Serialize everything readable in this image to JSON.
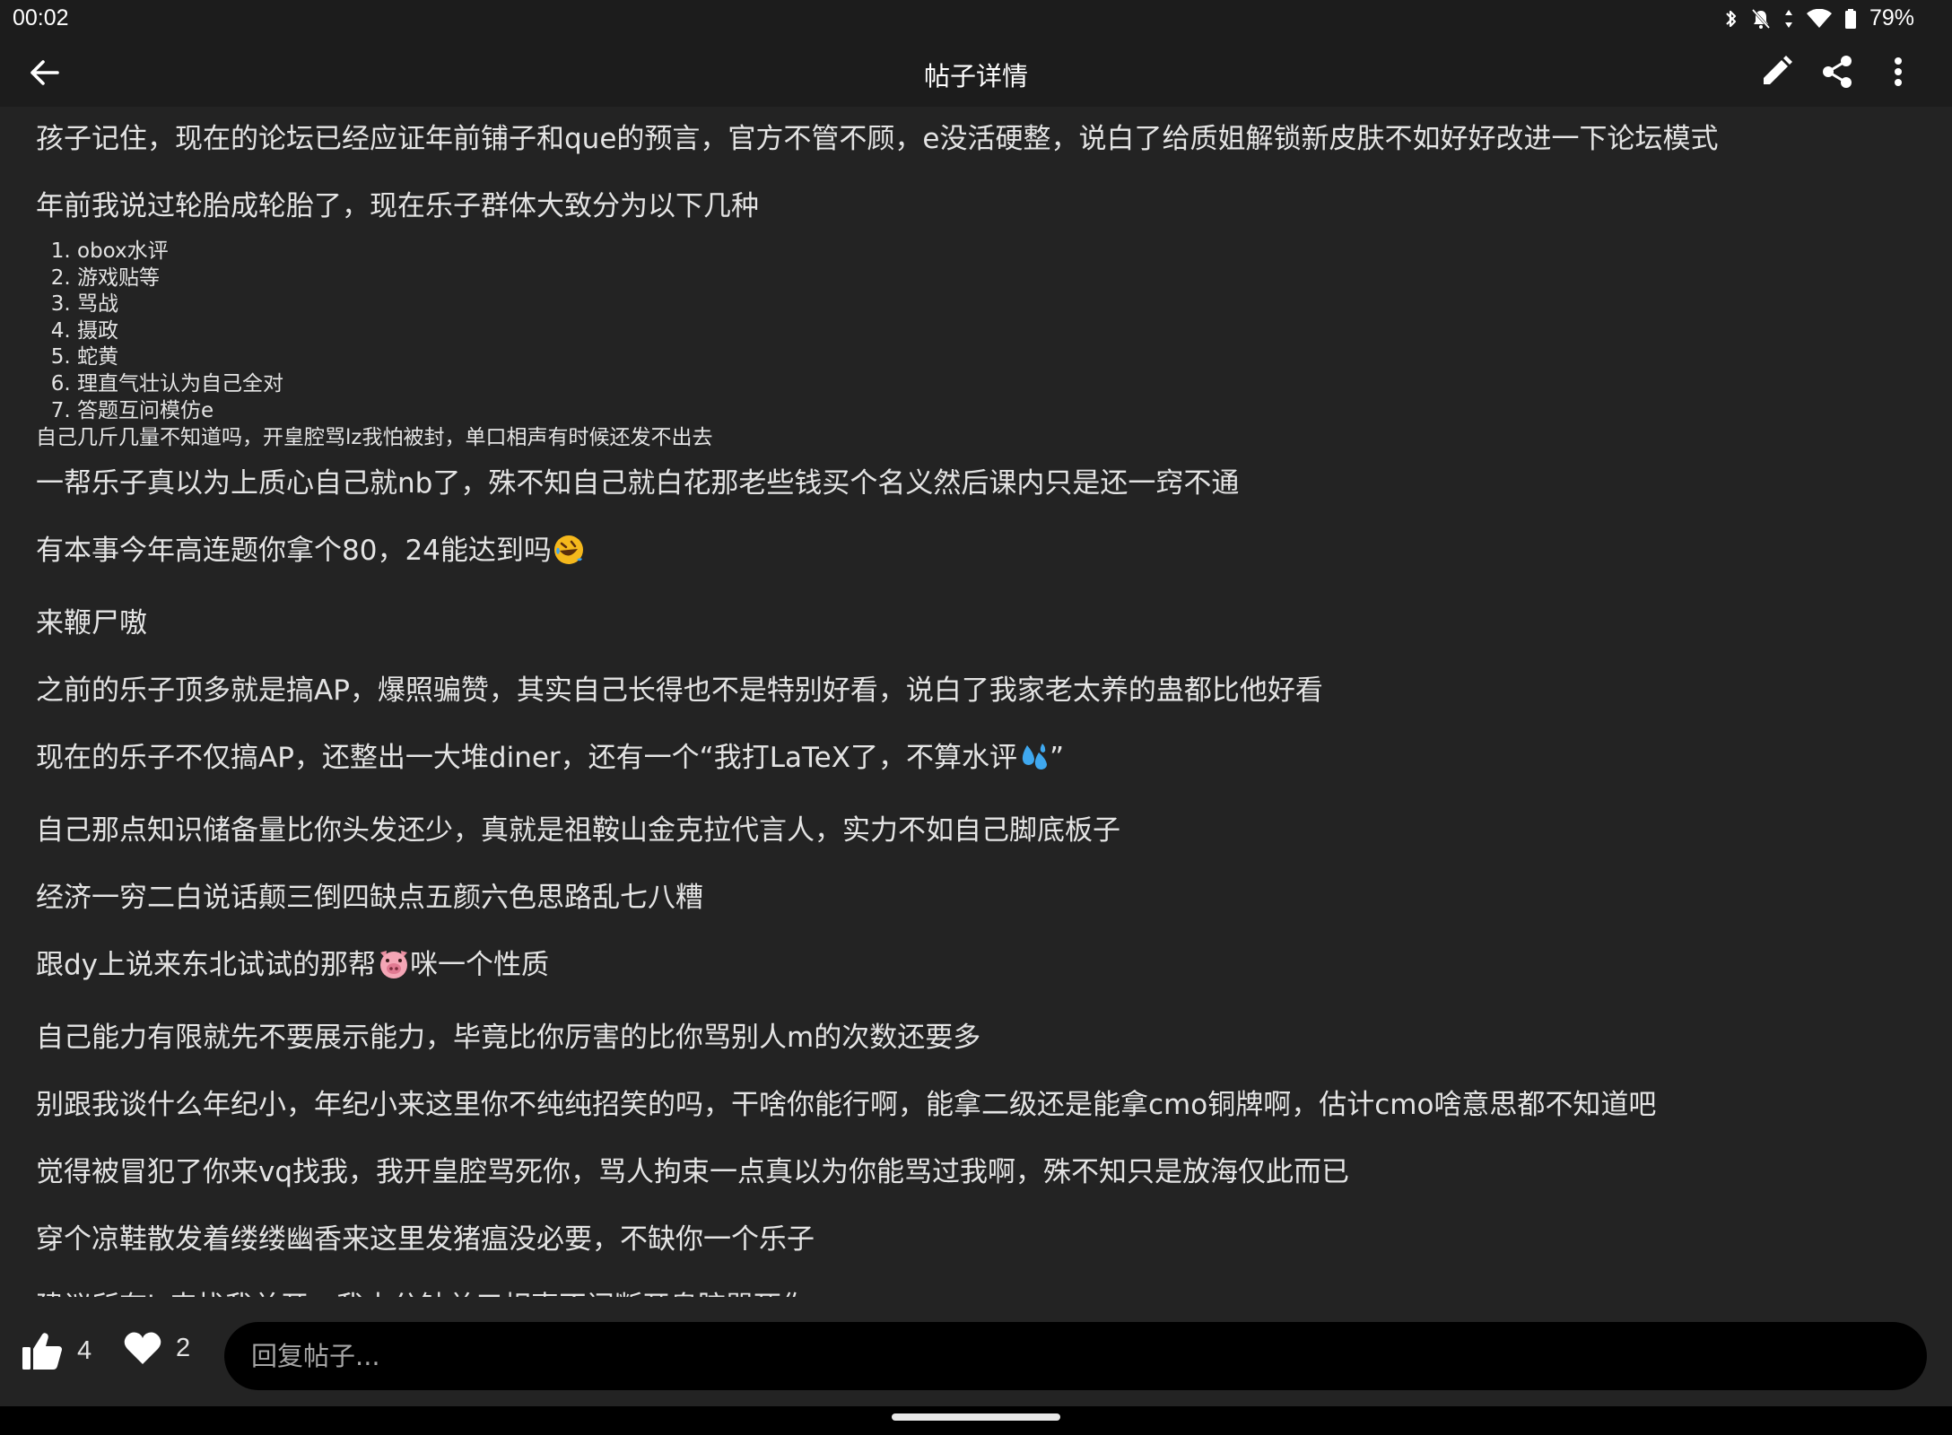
{
  "status_bar": {
    "time": "00:02",
    "battery": "79%",
    "icons": [
      "bluetooth-icon",
      "notifications-off-icon",
      "data-arrows-icon",
      "wifi-icon",
      "battery-icon"
    ]
  },
  "toolbar": {
    "title": "帖子详情",
    "back_icon": "arrow-left-icon",
    "actions": [
      "edit-icon",
      "share-icon",
      "more-vertical-icon"
    ]
  },
  "post": {
    "p1": "孩子记住，现在的论坛已经应证年前铺子和que的预言，官方不管不顾，e没活硬整，说白了给质姐解锁新皮肤不如好好改进一下论坛模式",
    "p2": "年前我说过轮胎成轮胎了，现在乐子群体大致分为以下几种",
    "list": [
      "obox水评",
      "游戏贴等",
      "骂战",
      "摄政",
      "蛇黄",
      "理直气壮认为自己全对",
      "答题互问模仿e"
    ],
    "after_list": "自己几斤几量不知道吗，开皇腔骂lz我怕被封，单口相声有时候还发不出去",
    "p3": "一帮乐子真以为上质心自己就nb了，殊不知自己就白花那老些钱买个名义然后课内只是还一窍不通",
    "p4": "有本事今年高连题你拿个80，24能达到吗",
    "p5": "来鞭尸嗷",
    "p6": "之前的乐子顶多就是搞AP，爆照骗赞，其实自己长得也不是特别好看，说白了我家老太养的蛊都比他好看",
    "p7a": "现在的乐子不仅搞AP，还整出一大堆diner，还有一个“我打LaTeX了，不算水评",
    "p7b": "”",
    "p8": "自己那点知识储备量比你头发还少，真就是祖鞍山金克拉代言人，实力不如自己脚底板子",
    "p9": "经济一穷二白说话颠三倒四缺点五颜六色思路乱七八糟",
    "p10a": "跟dy上说来东北试试的那帮",
    "p10b": "咪一个性质",
    "p11": "自己能力有限就先不要展示能力，毕竟比你厉害的比你骂别人m的次数还要多",
    "p12": "别跟我谈什么年纪小，年纪小来这里你不纯纯招笑的吗，干啥你能行啊，能拿二级还是能拿cmo铜牌啊，估计cmo啥意思都不知道吧",
    "p13": "觉得被冒犯了你来vq找我，我开皇腔骂死你，骂人拘束一点真以为你能骂过我啊，殊不知只是放海仅此而已",
    "p14": "穿个凉鞋散发着缕缕幽香来这里发猪瘟没必要，不缺你一个乐子",
    "p15": "建议所有lz来找我单开，我十分钟单口相声不间断开皇腔骂死你",
    "emojis": [
      "rolling-laughing-emoji",
      "sweat-droplets-emoji",
      "pig-face-emoji"
    ]
  },
  "bottom_bar": {
    "likes": "4",
    "favorites": "2",
    "reply_placeholder": "回复帖子..."
  },
  "colors": {
    "background": "#232323",
    "bar": "#1c1c1c",
    "text": "#e4e4e4",
    "input_bg": "#000000"
  }
}
